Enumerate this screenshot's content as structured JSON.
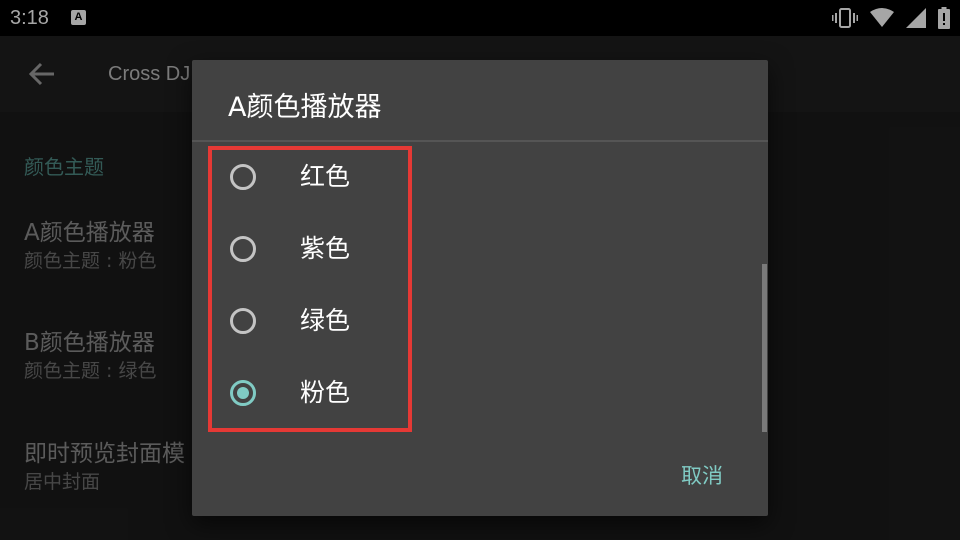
{
  "status_bar": {
    "time": "3:18",
    "notification_icon": "A",
    "icons": [
      "vibrate-icon",
      "wifi-icon",
      "signal-icon",
      "battery-icon"
    ]
  },
  "app_bar": {
    "title": "Cross DJ",
    "back_icon": "arrow-left-icon"
  },
  "preferences": {
    "category": "颜色主题",
    "items": [
      {
        "title": "A颜色播放器",
        "summary": "颜色主题 : 粉色"
      },
      {
        "title": "B颜色播放器",
        "summary": "颜色主题 : 绿色"
      },
      {
        "title": "即时预览封面模",
        "summary": "居中封面"
      }
    ]
  },
  "dialog": {
    "title": "A颜色播放器",
    "options": [
      {
        "label": "红色",
        "checked": false
      },
      {
        "label": "紫色",
        "checked": false
      },
      {
        "label": "绿色",
        "checked": false
      },
      {
        "label": "粉色",
        "checked": true
      }
    ],
    "cancel_label": "取消"
  },
  "colors": {
    "accent": "#80cbc4",
    "dialog_bg": "#424242",
    "highlight": "#e53935"
  }
}
